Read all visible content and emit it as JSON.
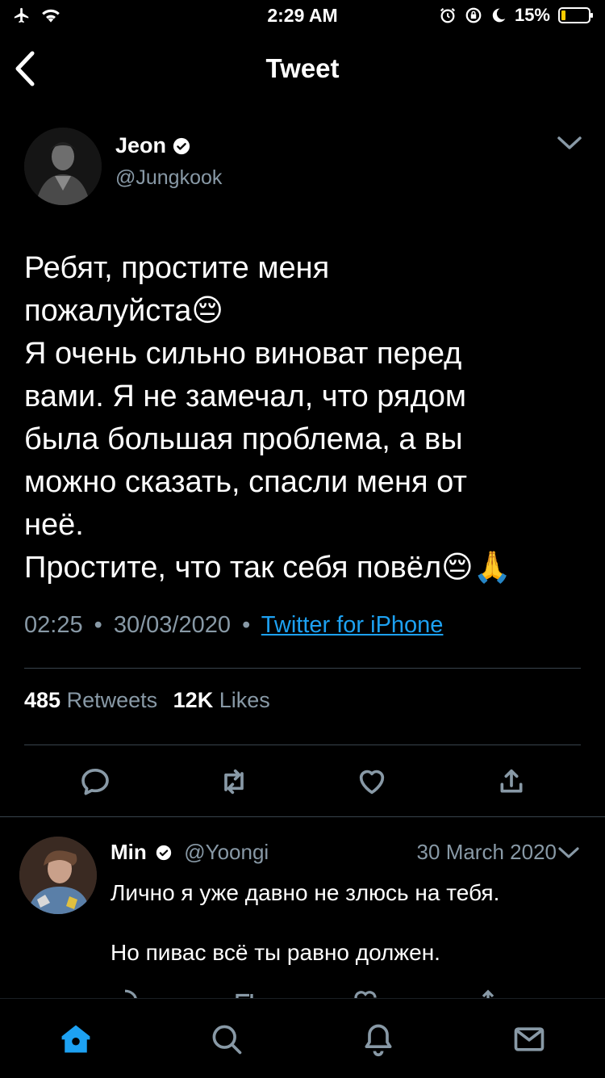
{
  "status_bar": {
    "time": "2:29 AM",
    "battery": "15%",
    "icons": [
      "airplane-icon",
      "wifi-icon",
      "alarm-icon",
      "orientation-lock-icon",
      "moon-icon",
      "battery-icon"
    ]
  },
  "header": {
    "title": "Tweet",
    "back_icon": "chevron-left-icon"
  },
  "tweet": {
    "author_name": "Jeon",
    "verified": true,
    "handle": "@Jungkook",
    "text": "Ребят, простите меня\nпожалуйста😔\nЯ очень сильно виноват перед\nвами. Я не замечал, что рядом\nбыла большая проблема, а вы\nможно сказать, спасли меня от\nнеё.\nПростите, что так себя повёл😔🙏",
    "time": "02:25",
    "date": "30/03/2020",
    "separator": "•",
    "source": "Twitter for iPhone",
    "retweets_count": "485",
    "retweets_label": "Retweets",
    "likes_count": "12K",
    "likes_label": "Likes",
    "actions": [
      "reply-icon",
      "retweet-icon",
      "like-icon",
      "share-icon"
    ]
  },
  "reply": {
    "author_name": "Min",
    "verified": true,
    "handle": "@Yoongi",
    "date": "30 March 2020",
    "text": "Лично я уже давно не злюсь на тебя.\n\nНо пивас всё ты равно должен."
  },
  "tab_bar": {
    "tabs": [
      "home-icon",
      "search-icon",
      "notifications-icon",
      "messages-icon"
    ],
    "active_tab": "home-icon"
  },
  "colors": {
    "background": "#000000",
    "accent": "#1da1f2",
    "secondary_text": "#8899a6",
    "divider": "#38444d"
  }
}
